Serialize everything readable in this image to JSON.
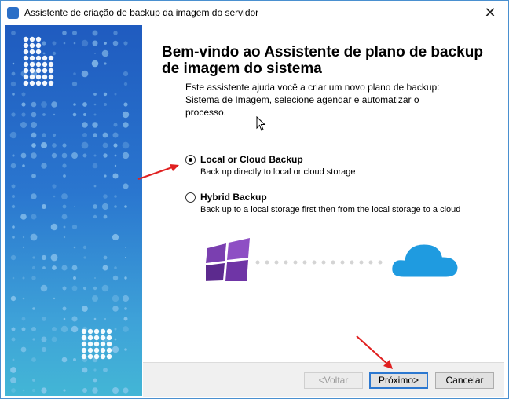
{
  "window": {
    "title": "Assistente de criação de backup da imagem do servidor",
    "close_glyph": "✕"
  },
  "content": {
    "heading": "Bem-vindo ao Assistente de plano de backup de imagem do sistema",
    "intro": "Este assistente ajuda você a criar um novo plano de backup: Sistema de Imagem, selecione agendar e automatizar o processo."
  },
  "options": [
    {
      "label": "Local or Cloud Backup",
      "desc": "Back up directly to local or cloud storage",
      "checked": true
    },
    {
      "label": "Hybrid Backup",
      "desc": "Back up to a local storage first then from the local storage to a cloud",
      "checked": false
    }
  ],
  "buttons": {
    "back": "<Voltar",
    "next": "Próximo>",
    "cancel": "Cancelar"
  },
  "colors": {
    "accent": "#2c78d0",
    "windows_logo": "#6a2f9f",
    "cloud": "#1f9be0",
    "annotation_arrow": "#e02020"
  },
  "icons": [
    "app-icon",
    "close-icon",
    "windows-logo-icon",
    "cloud-icon",
    "mouse-cursor-icon"
  ]
}
